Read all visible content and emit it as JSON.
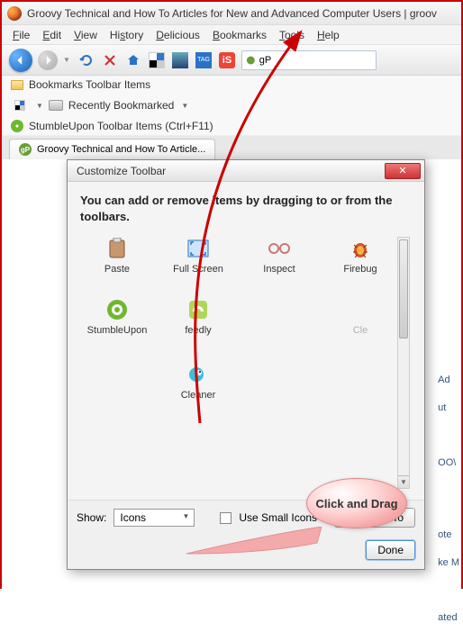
{
  "window": {
    "title": "Groovy Technical and How To Articles for New and Advanced Computer Users | groov"
  },
  "menu": {
    "file": "File",
    "edit": "Edit",
    "view": "View",
    "history": "History",
    "delicious": "Delicious",
    "bookmarks": "Bookmarks",
    "tools": "Tools",
    "help": "Help"
  },
  "search": {
    "value": "gP"
  },
  "bookmarks": {
    "toolbar_items": "Bookmarks Toolbar Items",
    "recently": "Recently Bookmarked",
    "stumble": "StumbleUpon Toolbar Items (Ctrl+F11)"
  },
  "tab": {
    "label": "Groovy Technical and How To Article..."
  },
  "dialog": {
    "title": "Customize Toolbar",
    "message": "You can add or remove items by dragging to or from the toolbars.",
    "items": {
      "paste": "Paste",
      "fullscreen": "Full Screen",
      "inspect": "Inspect",
      "firebug": "Firebug",
      "stumbleupon": "StumbleUpon",
      "feedly": "feedly",
      "cle": "Cle",
      "cleaner": "Cleaner"
    },
    "show_label": "Show:",
    "show_value": "Icons",
    "small_icons": "Use Small Icons",
    "add_new": "Add New To",
    "done": "Done"
  },
  "callout": {
    "text": "Click and Drag"
  },
  "side": {
    "a": "Ad",
    "b": "ut",
    "c": "OO\\",
    "d": "ote",
    "e": "ke M",
    "f": "ated"
  }
}
